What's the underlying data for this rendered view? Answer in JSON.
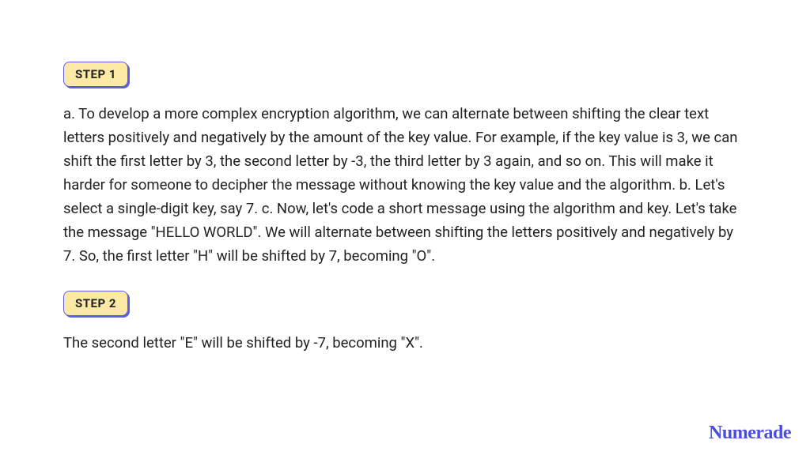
{
  "steps": [
    {
      "label": "STEP 1",
      "text": "a. To develop a more complex encryption algorithm, we can alternate between shifting the clear text letters positively and negatively by the amount of the key value. For example, if the key value is 3, we can shift the first letter by 3, the second letter by -3, the third letter by 3 again, and so on. This will make it harder for someone to decipher the message without knowing the key value and the algorithm. b. Let's select a single-digit key, say 7. c. Now, let's code a short message using the algorithm and key. Let's take the message \"HELLO WORLD\". We will alternate between shifting the letters positively and negatively by 7. So, the first letter \"H\" will be shifted by 7, becoming \"O\"."
    },
    {
      "label": "STEP 2",
      "text": "The second letter \"E\" will be shifted by -7, becoming \"X\"."
    }
  ],
  "brand": "Numerade"
}
